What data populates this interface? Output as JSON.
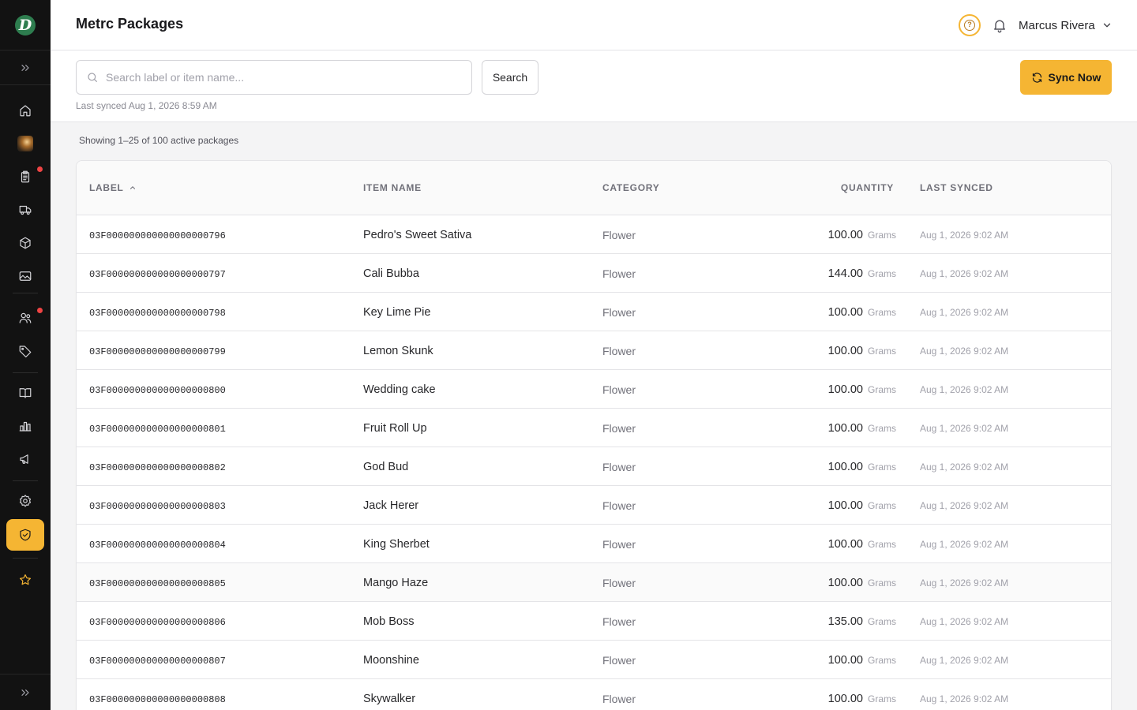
{
  "header": {
    "title": "Metrc Packages",
    "user_name": "Marcus Rivera"
  },
  "sidebar": {
    "logo_letter": "D",
    "nav": [
      {
        "id": "home",
        "icon": "home-icon"
      },
      {
        "id": "thumbnail",
        "icon": "image-thumbnail-icon"
      },
      {
        "id": "orders",
        "icon": "clipboard-icon",
        "badge": true
      },
      {
        "id": "delivery",
        "icon": "truck-icon"
      },
      {
        "id": "products",
        "icon": "box-icon"
      },
      {
        "id": "media",
        "icon": "image-icon"
      },
      {
        "id": "customers",
        "icon": "users-icon",
        "badge": true
      },
      {
        "id": "discounts",
        "icon": "tag-icon"
      },
      {
        "id": "catalog",
        "icon": "book-open-icon"
      },
      {
        "id": "reports",
        "icon": "bar-chart-icon"
      },
      {
        "id": "marketing",
        "icon": "megaphone-icon"
      },
      {
        "id": "settings",
        "icon": "gear-icon"
      },
      {
        "id": "compliance",
        "icon": "shield-check-icon",
        "active": true
      },
      {
        "id": "favorites",
        "icon": "star-icon"
      }
    ]
  },
  "toolbar": {
    "search_placeholder": "Search label or item name...",
    "search_value": "",
    "search_button": "Search",
    "last_synced": "Last synced Aug 1, 2026 8:59 AM",
    "sync_button": "Sync Now"
  },
  "summary": "Showing 1–25 of 100 active packages",
  "table": {
    "columns": {
      "label": "LABEL",
      "item_name": "ITEM NAME",
      "category": "CATEGORY",
      "quantity": "QUANTITY",
      "last_synced": "LAST SYNCED"
    },
    "sort": {
      "column": "label",
      "direction": "asc"
    },
    "rows": [
      {
        "label": "03F000000000000000000796",
        "item_name": "Pedro's Sweet Sativa",
        "category": "Flower",
        "quantity": "100.00",
        "unit": "Grams",
        "last_synced": "Aug 1, 2026 9:02 AM"
      },
      {
        "label": "03F000000000000000000797",
        "item_name": "Cali Bubba",
        "category": "Flower",
        "quantity": "144.00",
        "unit": "Grams",
        "last_synced": "Aug 1, 2026 9:02 AM"
      },
      {
        "label": "03F000000000000000000798",
        "item_name": "Key Lime Pie",
        "category": "Flower",
        "quantity": "100.00",
        "unit": "Grams",
        "last_synced": "Aug 1, 2026 9:02 AM"
      },
      {
        "label": "03F000000000000000000799",
        "item_name": "Lemon Skunk",
        "category": "Flower",
        "quantity": "100.00",
        "unit": "Grams",
        "last_synced": "Aug 1, 2026 9:02 AM"
      },
      {
        "label": "03F000000000000000000800",
        "item_name": "Wedding cake",
        "category": "Flower",
        "quantity": "100.00",
        "unit": "Grams",
        "last_synced": "Aug 1, 2026 9:02 AM"
      },
      {
        "label": "03F000000000000000000801",
        "item_name": "Fruit Roll Up",
        "category": "Flower",
        "quantity": "100.00",
        "unit": "Grams",
        "last_synced": "Aug 1, 2026 9:02 AM"
      },
      {
        "label": "03F000000000000000000802",
        "item_name": "God Bud",
        "category": "Flower",
        "quantity": "100.00",
        "unit": "Grams",
        "last_synced": "Aug 1, 2026 9:02 AM"
      },
      {
        "label": "03F000000000000000000803",
        "item_name": "Jack Herer",
        "category": "Flower",
        "quantity": "100.00",
        "unit": "Grams",
        "last_synced": "Aug 1, 2026 9:02 AM"
      },
      {
        "label": "03F000000000000000000804",
        "item_name": "King Sherbet",
        "category": "Flower",
        "quantity": "100.00",
        "unit": "Grams",
        "last_synced": "Aug 1, 2026 9:02 AM"
      },
      {
        "label": "03F000000000000000000805",
        "item_name": "Mango Haze",
        "category": "Flower",
        "quantity": "100.00",
        "unit": "Grams",
        "last_synced": "Aug 1, 2026 9:02 AM",
        "hover": true
      },
      {
        "label": "03F000000000000000000806",
        "item_name": "Mob Boss",
        "category": "Flower",
        "quantity": "135.00",
        "unit": "Grams",
        "last_synced": "Aug 1, 2026 9:02 AM"
      },
      {
        "label": "03F000000000000000000807",
        "item_name": "Moonshine",
        "category": "Flower",
        "quantity": "100.00",
        "unit": "Grams",
        "last_synced": "Aug 1, 2026 9:02 AM"
      },
      {
        "label": "03F000000000000000000808",
        "item_name": "Skywalker",
        "category": "Flower",
        "quantity": "100.00",
        "unit": "Grams",
        "last_synced": "Aug 1, 2026 9:02 AM"
      }
    ]
  },
  "colors": {
    "accent": "#f5b533",
    "sidebar_bg": "#121212",
    "badge": "#ef4444",
    "logo": "#2e7d4f"
  }
}
